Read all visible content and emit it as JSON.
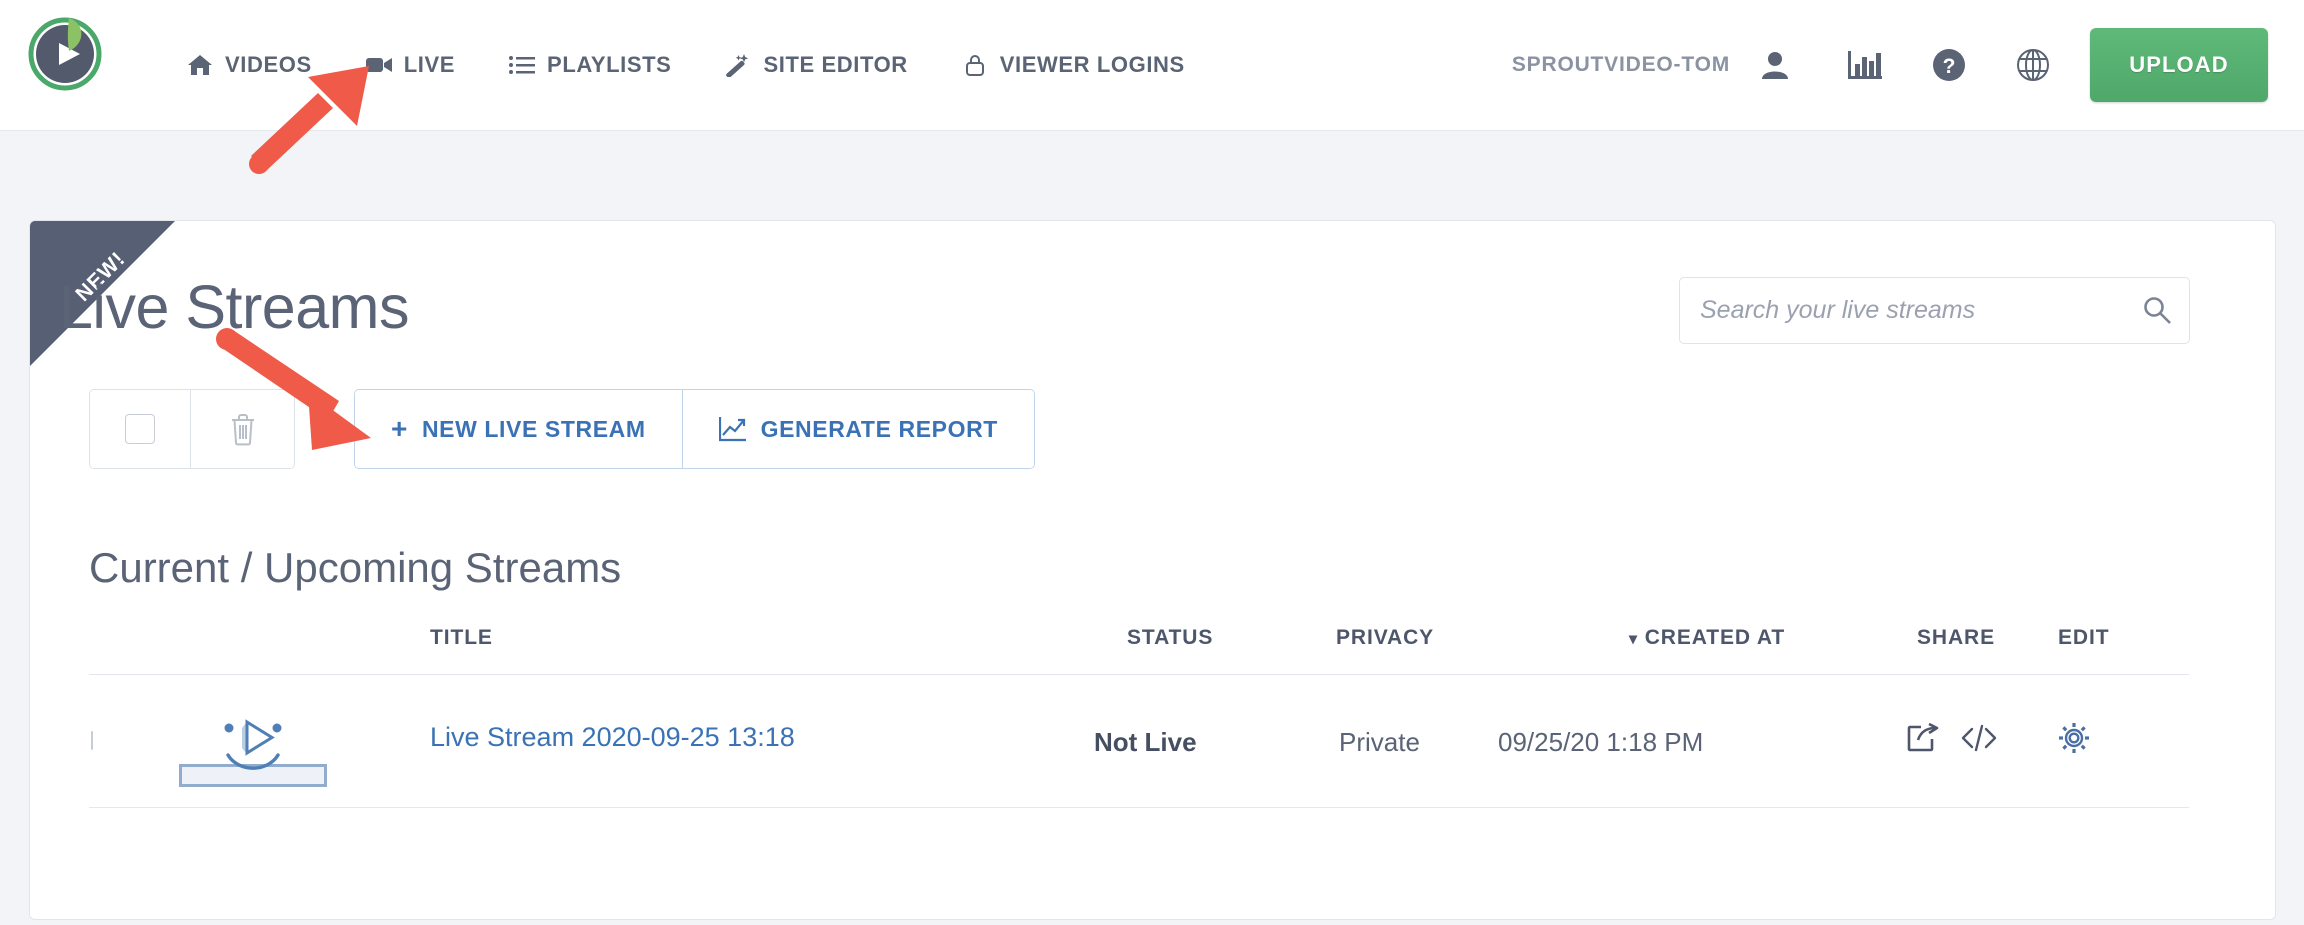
{
  "nav": {
    "logo_name": "sproutvideo-logo",
    "links": [
      {
        "label": "VIDEOS",
        "icon": "home-icon"
      },
      {
        "label": "LIVE",
        "icon": "video-camera-icon"
      },
      {
        "label": "PLAYLISTS",
        "icon": "list-icon"
      },
      {
        "label": "SITE EDITOR",
        "icon": "magic-wand-icon"
      },
      {
        "label": "VIEWER LOGINS",
        "icon": "lock-icon"
      }
    ],
    "account_name": "SPROUTVIDEO-TOM",
    "account_icon": "user-icon",
    "stats_icon": "bar-chart-icon",
    "help_icon": "question-circle-icon",
    "globe_icon": "globe-icon",
    "upload_label": "UPLOAD",
    "upload_color": "#56b074"
  },
  "card": {
    "ribbon_label": "NEW!",
    "ribbon_color": "#565f73",
    "title": "Live Streams"
  },
  "search": {
    "placeholder": "Search your live streams",
    "value": "",
    "icon": "search-icon"
  },
  "toolbar": {
    "select_all_name": "select-all-checkbox",
    "delete_icon": "trash-icon",
    "new_stream_label": "NEW LIVE STREAM",
    "new_stream_prefix": "+",
    "generate_report_label": "GENERATE REPORT",
    "report_icon": "line-chart-icon",
    "accent_color": "#3a72b5"
  },
  "table": {
    "section_title": "Current / Upcoming Streams",
    "columns": {
      "title": "TITLE",
      "status": "STATUS",
      "privacy": "PRIVACY",
      "created_at": "CREATED AT",
      "created_at_caret": "▾",
      "share": "SHARE",
      "edit": "EDIT"
    },
    "rows": [
      {
        "selected": false,
        "thumbnail": "smiley-play-placeholder",
        "title": "Live Stream 2020-09-25 13:18",
        "status": "Not Live",
        "privacy": "Private",
        "created_at": "09/25/20 1:18 PM",
        "share_icon": "share-icon",
        "embed_icon": "embed-code-icon",
        "edit_icon": "gear-icon"
      }
    ]
  },
  "annotations": {
    "arrow_color": "#ef5a49",
    "arrows": [
      {
        "name": "arrow-to-live-nav"
      },
      {
        "name": "arrow-to-new-live-stream"
      }
    ]
  }
}
